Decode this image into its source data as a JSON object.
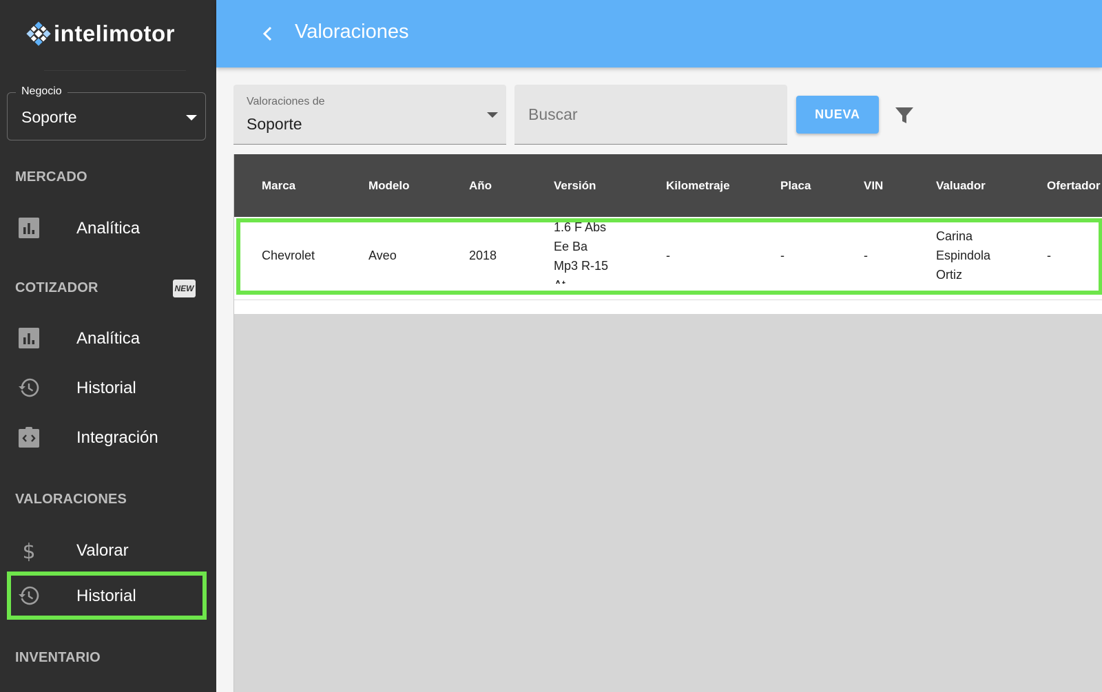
{
  "app": {
    "logo_text": "intelimotor",
    "colors": {
      "accent": "#5fb1f8",
      "sidebar": "#2f2f2f",
      "highlight": "#6ee54b",
      "table_header": "#484848"
    }
  },
  "sidebar": {
    "negocio": {
      "label": "Negocio",
      "value": "Soporte"
    },
    "sections": {
      "mercado": "MERCADO",
      "cotizador": "COTIZADOR",
      "cotizador_badge": "NEW",
      "valoraciones": "VALORACIONES",
      "inventario": "INVENTARIO"
    },
    "items": [
      {
        "label": "Analítica",
        "icon": "bar-chart-icon"
      },
      {
        "label": "Analítica",
        "icon": "bar-chart-icon"
      },
      {
        "label": "Historial",
        "icon": "history-icon"
      },
      {
        "label": "Integración",
        "icon": "integration-icon"
      },
      {
        "label": "Valorar",
        "icon": "dollar-icon"
      },
      {
        "label": "Historial",
        "icon": "history-icon",
        "active": true
      }
    ]
  },
  "header": {
    "title": "Valoraciones"
  },
  "filters": {
    "select_label": "Valoraciones de",
    "select_value": "Soporte",
    "search_placeholder": "Buscar",
    "new_button": "NUEVA"
  },
  "table": {
    "columns": [
      "Marca",
      "Modelo",
      "Año",
      "Versión",
      "Kilometraje",
      "Placa",
      "VIN",
      "Valuador",
      "Ofertador"
    ],
    "rows": [
      {
        "marca": "Chevrolet",
        "modelo": "Aveo",
        "anio": "2018",
        "version": [
          "1.6 F Abs",
          "Ee Ba",
          "Mp3 R-15",
          "At"
        ],
        "kilometraje": "-",
        "placa": "-",
        "vin": "-",
        "valuador": [
          "Carina",
          "Espindola",
          "Ortiz"
        ],
        "ofertador": "-"
      }
    ]
  }
}
